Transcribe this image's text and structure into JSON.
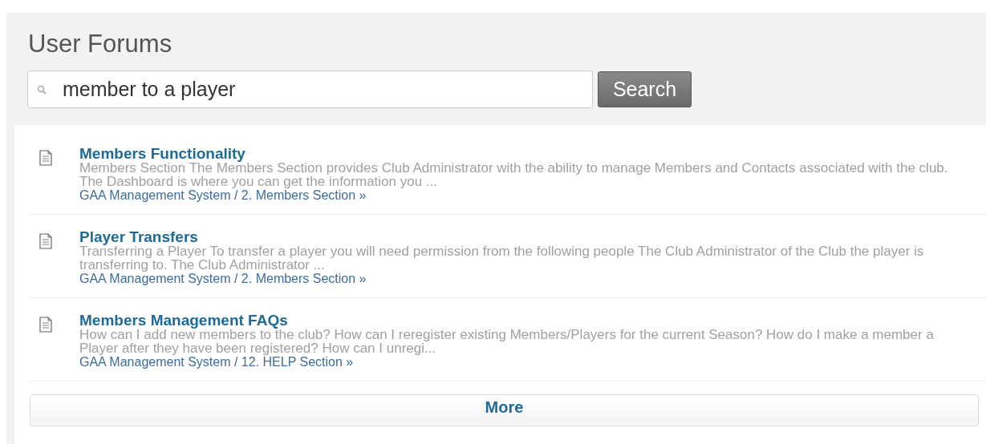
{
  "page": {
    "title": "User Forums"
  },
  "search": {
    "value": "member to a player",
    "button": "Search"
  },
  "results": [
    {
      "title": "Members Functionality",
      "snippet": "Members Section The Members Section provides Club Administrator with the ability to manage Members and Contacts associated with the club. The Dashboard is where you can get the information you ...",
      "path": "GAA Management System / 2. Members Section »"
    },
    {
      "title": "Player Transfers",
      "snippet": "Transferring a Player To transfer a player you will need permission from the following people The Club Administrator of the Club the player is transferring to. The Club Administrator ...",
      "path": "GAA Management System / 2. Members Section »"
    },
    {
      "title": "Members Management FAQs",
      "snippet": "How can I add new members to the club? How can I reregister existing Members/Players for the current Season? How do I make a member a Player after they have been registered? How can I unregi...",
      "path": "GAA Management System / 12. HELP Section »"
    }
  ],
  "more_button": "More"
}
